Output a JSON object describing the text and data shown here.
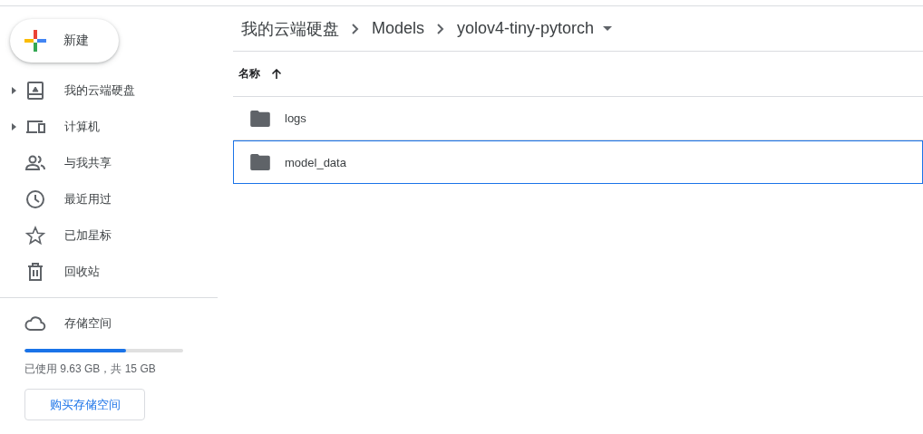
{
  "new_button": {
    "label": "新建"
  },
  "sidebar": {
    "items": [
      {
        "kind": "drive",
        "label": "我的云端硬盘",
        "expandable": true
      },
      {
        "kind": "computer",
        "label": "计算机",
        "expandable": true
      },
      {
        "kind": "shared",
        "label": "与我共享",
        "expandable": false
      },
      {
        "kind": "recent",
        "label": "最近用过",
        "expandable": false
      },
      {
        "kind": "starred",
        "label": "已加星标",
        "expandable": false
      },
      {
        "kind": "trash",
        "label": "回收站",
        "expandable": false
      }
    ]
  },
  "storage": {
    "label": "存储空间",
    "level": 0.642,
    "usage": "已使用 9.63 GB，共 15 GB",
    "buy_button": "购买存储空间"
  },
  "breadcrumb": [
    "我的云端硬盘",
    "Models",
    "yolov4-tiny-pytorch"
  ],
  "table": {
    "columns": [
      {
        "label": "名称",
        "ascending": true
      }
    ],
    "rows": [
      {
        "name": "logs",
        "selected": false
      },
      {
        "name": "model_data",
        "selected": true
      }
    ]
  }
}
